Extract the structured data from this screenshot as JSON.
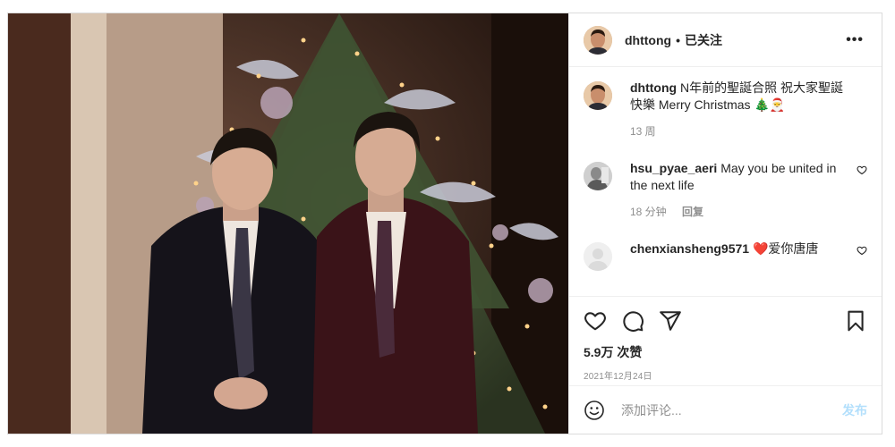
{
  "post": {
    "author": "dhttong",
    "separator": "•",
    "follow_status": "已关注",
    "more_icon": "more-horizontal-icon"
  },
  "caption": {
    "username": "dhttong",
    "text": "N年前的聖誕合照 祝大家聖誕快樂 Merry Christmas 🎄🎅",
    "age": "13 周"
  },
  "comments": [
    {
      "username": "hsu_pyae_aeri",
      "text": "May you be united in the next life",
      "age": "18 分钟",
      "reply_label": "回复"
    },
    {
      "username": "chenxiansheng9571",
      "text": "❤️爱你唐唐"
    }
  ],
  "actions": {
    "like_icon": "heart-icon",
    "comment_icon": "comment-icon",
    "share_icon": "share-icon",
    "save_icon": "bookmark-icon"
  },
  "stats": {
    "views": "5.9万 次赞",
    "date": "2021年12月24日"
  },
  "add_comment": {
    "placeholder": "添加评论...",
    "publish_label": "发布",
    "emoji_icon": "emoji-icon"
  },
  "colors": {
    "text": "#262626",
    "secondary": "#8e8e8e",
    "publish_disabled": "#b2dffc",
    "border": "#efefef"
  }
}
